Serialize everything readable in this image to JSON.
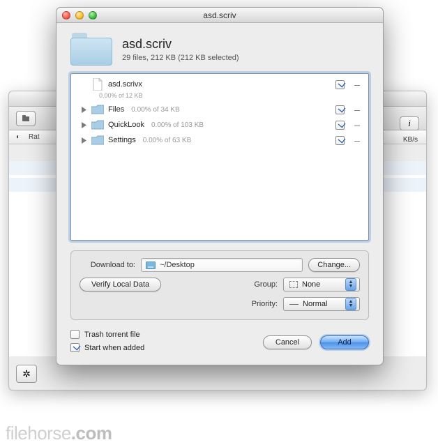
{
  "window": {
    "title": "asd.scriv"
  },
  "header": {
    "title": "asd.scriv",
    "subtitle": "29 files, 212 KB (212 KB selected)"
  },
  "files": [
    {
      "name": "asd.scrivx",
      "type": "file",
      "sub": "0.00% of 12 KB",
      "checked": true,
      "expandable": false
    },
    {
      "name": "Files",
      "type": "folder",
      "sub": "0.00% of 34 KB",
      "checked": true,
      "expandable": true
    },
    {
      "name": "QuickLook",
      "type": "folder",
      "sub": "0.00% of 103 KB",
      "checked": true,
      "expandable": true
    },
    {
      "name": "Settings",
      "type": "folder",
      "sub": "0.00% of 63 KB",
      "checked": true,
      "expandable": true
    }
  ],
  "options": {
    "downloadToLabel": "Download to:",
    "downloadToPath": "~/Desktop",
    "changeLabel": "Change...",
    "verifyLabel": "Verify Local Data",
    "groupLabel": "Group:",
    "groupValue": "None",
    "priorityLabel": "Priority:",
    "priorityValue": "Normal"
  },
  "footer": {
    "trashLabel": "Trash torrent file",
    "trashChecked": false,
    "startLabel": "Start when added",
    "startChecked": true,
    "cancelLabel": "Cancel",
    "addLabel": "Add"
  },
  "background": {
    "ratLabel": "Rat",
    "kbs": "KB/s"
  },
  "watermark": {
    "a": "filehorse",
    "b": ".com"
  }
}
